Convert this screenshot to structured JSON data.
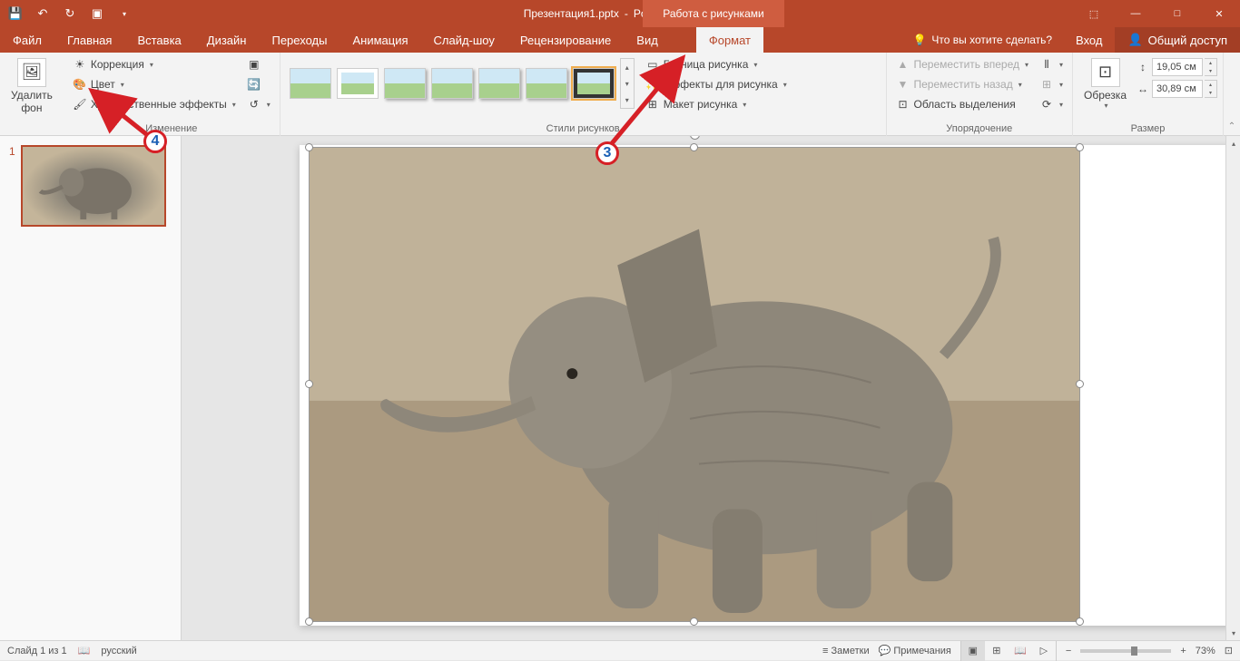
{
  "title": {
    "doc": "Презентация1.pptx",
    "app": "PowerPoint",
    "context": "Работа с рисунками"
  },
  "qat": {
    "save": "save-icon",
    "undo": "undo-icon",
    "redo": "redo-icon",
    "slideshow": "slideshow-icon"
  },
  "wincontrols": {
    "options": "ribbon-options",
    "minimize": "—",
    "maximize": "□",
    "close": "✕"
  },
  "tabs": {
    "file": "Файл",
    "home": "Главная",
    "insert": "Вставка",
    "design": "Дизайн",
    "transitions": "Переходы",
    "animations": "Анимация",
    "slideshow": "Слайд-шоу",
    "review": "Рецензирование",
    "view": "Вид",
    "format": "Формат"
  },
  "tellme": {
    "placeholder": "Что вы хотите сделать?",
    "lamp": "lightbulb-icon"
  },
  "signin": {
    "label": "Вход"
  },
  "share": {
    "label": "Общий доступ"
  },
  "ribbon": {
    "remove_bg": {
      "line1": "Удалить",
      "line2": "фон"
    },
    "adjust": {
      "corrections": "Коррекция",
      "color": "Цвет",
      "artistic": "Художественные эффекты",
      "compress": "compress-icon",
      "change": "change-picture-icon",
      "reset": "reset-icon",
      "group": "Изменение"
    },
    "styles": {
      "group": "Стили рисунков",
      "border": "Граница рисунка",
      "effects": "Эффекты для рисунка",
      "layout": "Макет рисунка"
    },
    "arrange": {
      "group": "Упорядочение",
      "forward": "Переместить вперед",
      "backward": "Переместить назад",
      "selection": "Область выделения",
      "align": "align-icon",
      "group_btn": "group-icon",
      "rotate": "rotate-icon"
    },
    "size": {
      "group": "Размер",
      "crop": "Обрезка",
      "height": "19,05 см",
      "width": "30,89 см"
    }
  },
  "thumbs": {
    "slide1": "1"
  },
  "status": {
    "slide": "Слайд 1 из 1",
    "lang": "русский",
    "notes": "Заметки",
    "comments": "Примечания",
    "zoom": "73%"
  },
  "annotations": {
    "a3": "3",
    "a4": "4"
  }
}
